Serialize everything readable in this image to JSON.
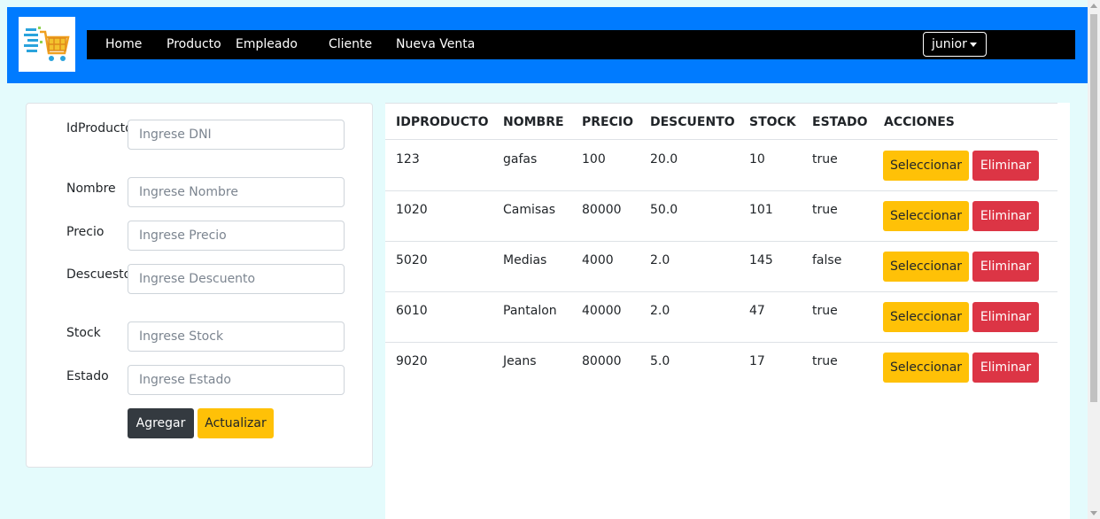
{
  "nav": {
    "items": [
      {
        "label": "Home"
      },
      {
        "label": "Producto"
      },
      {
        "label": "Empleado"
      },
      {
        "label": "Cliente"
      },
      {
        "label": "Nueva Venta"
      }
    ],
    "user": "junior"
  },
  "form": {
    "fields": [
      {
        "label": "IdProducto",
        "placeholder": "Ingrese DNI",
        "value": ""
      },
      {
        "label": "Nombre",
        "placeholder": "Ingrese Nombre",
        "value": ""
      },
      {
        "label": "Precio",
        "placeholder": "Ingrese Precio",
        "value": ""
      },
      {
        "label": "Descuesto",
        "placeholder": "Ingrese Descuento",
        "value": ""
      },
      {
        "label": "Stock",
        "placeholder": "Ingrese Stock",
        "value": ""
      },
      {
        "label": "Estado",
        "placeholder": "Ingrese Estado",
        "value": ""
      }
    ],
    "add_label": "Agregar",
    "update_label": "Actualizar"
  },
  "table": {
    "columns": [
      "IDPRODUCTO",
      "NOMBRE",
      "PRECIO",
      "DESCUENTO",
      "STOCK",
      "ESTADO",
      "ACCIONES"
    ],
    "rows": [
      {
        "cells": [
          "123",
          "gafas",
          "100",
          "20.0",
          "10",
          "true"
        ]
      },
      {
        "cells": [
          "1020",
          "Camisas",
          "80000",
          "50.0",
          "101",
          "true"
        ]
      },
      {
        "cells": [
          "5020",
          "Medias",
          "4000",
          "2.0",
          "145",
          "false"
        ]
      },
      {
        "cells": [
          "6010",
          "Pantalon",
          "40000",
          "2.0",
          "47",
          "true"
        ]
      },
      {
        "cells": [
          "9020",
          "Jeans",
          "80000",
          "5.0",
          "17",
          "true"
        ]
      }
    ],
    "select_label": "Seleccionar",
    "delete_label": "Eliminar"
  },
  "colors": {
    "primary": "#007bff",
    "navbar": "#000000",
    "warning": "#ffc107",
    "danger": "#dc3545",
    "dark": "#343a40",
    "page_bg": "#e4fbfc"
  },
  "icons": {
    "logo": "shopping-cart-logo-icon",
    "user_caret": "caret-down-icon"
  }
}
